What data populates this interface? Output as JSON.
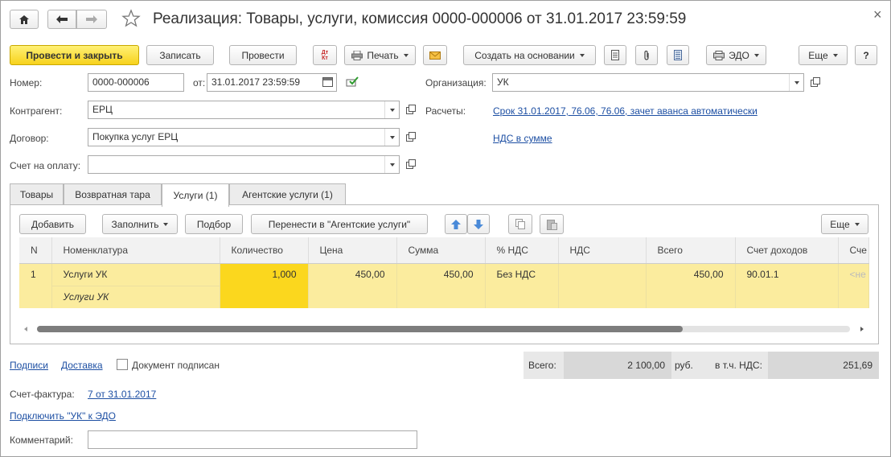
{
  "window": {
    "title": "Реализация: Товары, услуги, комиссия 0000-000006 от 31.01.2017 23:59:59",
    "close_glyph": "×"
  },
  "toolbar": {
    "post_close": "Провести и закрыть",
    "save": "Записать",
    "post": "Провести",
    "dtkt_glyph": "Дт Кт",
    "print": "Печать",
    "create_based": "Создать на основании",
    "edo": "ЭДО",
    "more": "Еще",
    "help": "?"
  },
  "form": {
    "number_label": "Номер:",
    "number_value": "0000-000006",
    "date_label": "от:",
    "date_value": "31.01.2017 23:59:59",
    "org_label": "Организация:",
    "org_value": "УК",
    "contractor_label": "Контрагент:",
    "contractor_value": "ЕРЦ",
    "settlements_label": "Расчеты:",
    "settlements_link": "Срок 31.01.2017, 76.06, 76.06, зачет аванса автоматически",
    "contract_label": "Договор:",
    "contract_value": "Покупка услуг ЕРЦ",
    "vat_link": "НДС в сумме",
    "invoice_label": "Счет на оплату:",
    "invoice_value": ""
  },
  "tabs": [
    {
      "label": "Товары"
    },
    {
      "label": "Возвратная тара"
    },
    {
      "label": "Услуги (1)"
    },
    {
      "label": "Агентские услуги (1)"
    }
  ],
  "table_toolbar": {
    "add": "Добавить",
    "fill": "Заполнить",
    "pick": "Подбор",
    "move_agent": "Перенести в \"Агентские услуги\"",
    "more": "Еще"
  },
  "table": {
    "columns": [
      "N",
      "Номенклатура",
      "Количество",
      "Цена",
      "Сумма",
      "% НДС",
      "НДС",
      "Всего",
      "Счет доходов",
      "Сче"
    ],
    "rows": [
      {
        "n": "1",
        "item": "Услуги УК",
        "item_content": "Услуги УК",
        "qty": "1,000",
        "price": "450,00",
        "sum": "450,00",
        "vat_rate": "Без НДС",
        "vat": "",
        "total": "450,00",
        "income_account": "90.01.1",
        "next": "<не"
      }
    ]
  },
  "footer": {
    "signatures_link": "Подписи",
    "delivery_link": "Доставка",
    "signed_label": "Документ подписан",
    "total_label": "Всего:",
    "total_value": "2 100,00",
    "currency": "руб.",
    "vat_label": "в т.ч. НДС:",
    "vat_value": "251,69",
    "invoice_label": "Счет-фактура:",
    "invoice_link": "7 от 31.01.2017",
    "connect_edo_link": "Подключить \"УК\" к ЭДО",
    "comment_label": "Комментарий:",
    "comment_value": ""
  }
}
